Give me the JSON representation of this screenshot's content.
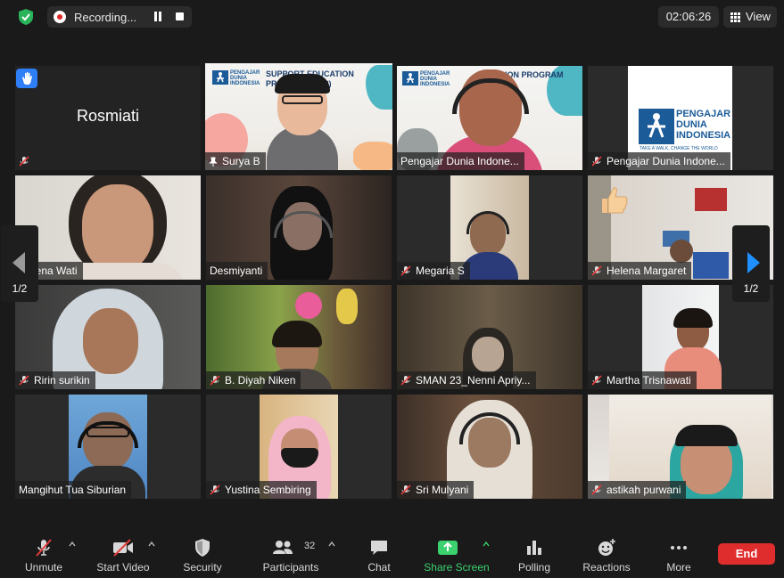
{
  "topbar": {
    "recording_label": "Recording...",
    "timer": "02:06:26",
    "view_label": "View"
  },
  "tiles": [
    {
      "name": "Rosmiati",
      "muted": true,
      "camera_off": true
    },
    {
      "name": "Surya B",
      "pinned": true
    },
    {
      "name": "Pengajar Dunia Indone..."
    },
    {
      "name": "Pengajar Dunia Indone...",
      "muted": true
    },
    {
      "name": "Serena Wati"
    },
    {
      "name": "Desmiyanti"
    },
    {
      "name": "Megaria S",
      "muted": true
    },
    {
      "name": "Helena Margaret",
      "muted": true
    },
    {
      "name": "Ririn surikin",
      "muted": true
    },
    {
      "name": "B. Diyah Niken",
      "muted": true
    },
    {
      "name": "SMAN 23_Nenni Apriy...",
      "muted": true
    },
    {
      "name": "Martha Trisnawati",
      "muted": true
    },
    {
      "name": "Mangihut Tua Siburian"
    },
    {
      "name": "Yustina Sembiring",
      "muted": true
    },
    {
      "name": "Sri Mulyani",
      "muted": true
    },
    {
      "name": "astikah purwani",
      "muted": true
    }
  ],
  "banner": {
    "program_title": "SUPPORT EDUCATION PROGRAM",
    "program_title_partial": "SUPPORT EDUCATION PROGRAM (SEP)",
    "program_title_cut": "ION PROGRAM",
    "logo_line1": "PENGAJAR",
    "logo_line2": "DUNIA",
    "logo_line3": "INDONESIA",
    "tagline": "TAKE A WALK, CHANGE THE WORLD"
  },
  "pagination": {
    "left": "1/2",
    "right": "1/2"
  },
  "toolbar": {
    "unmute": "Unmute",
    "start_video": "Start Video",
    "security": "Security",
    "participants": "Participants",
    "participants_count": "32",
    "chat": "Chat",
    "share_screen": "Share Screen",
    "polling": "Polling",
    "reactions": "Reactions",
    "more": "More",
    "end": "End"
  },
  "colors": {
    "active_speaker": "#d7ec6b",
    "end_button": "#df2d2d",
    "share_green": "#3bd16f",
    "hand_blue": "#2d7ef7",
    "nav_arrow_blue": "#1e90ff"
  }
}
